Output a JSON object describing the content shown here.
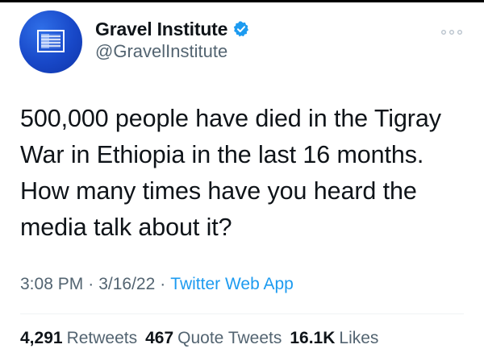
{
  "account": {
    "display_name": "Gravel Institute",
    "handle": "@GravelInstitute",
    "verified": true,
    "avatar_icon": "gravel-institute-logo",
    "avatar_color": "#1d4fd6"
  },
  "menu": {
    "icon": "more-icon"
  },
  "tweet": {
    "text": "500,000 people have died in the Tigray War in Ethiopia in the last 16 months. How many times have you heard the media talk about it?",
    "time": "3:08 PM",
    "date": "3/16/22",
    "source": "Twitter Web App",
    "separator": "·"
  },
  "stats": {
    "retweets_count": "4,291",
    "retweets_label": "Retweets",
    "quotes_count": "467",
    "quotes_label": "Quote Tweets",
    "likes_count": "16.1K",
    "likes_label": "Likes"
  },
  "colors": {
    "accent": "#1d9bf0",
    "text": "#0f1419",
    "secondary_text": "#536471"
  }
}
